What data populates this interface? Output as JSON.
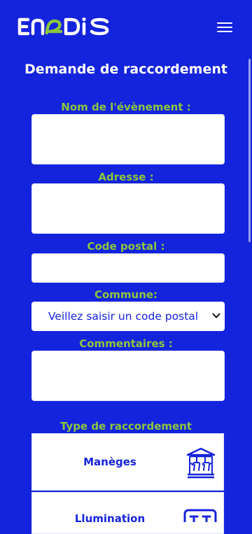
{
  "header": {
    "logo_text": "ENEDIS",
    "menu_icon": "hamburger-icon"
  },
  "form": {
    "title": "Demande de raccordement",
    "event_name_label": "Nom de l'évènement :",
    "event_name_value": "",
    "address_label": "Adresse :",
    "address_value": "",
    "postal_code_label": "Code postal :",
    "postal_code_value": "",
    "commune_label": "Commune:",
    "commune_selected": "Veillez saisir un code postal",
    "comments_label": "Commentaires :",
    "comments_value": "",
    "connection_type_label": "Type de raccordement",
    "connection_types": [
      {
        "label": "Manèges",
        "icon": "carousel-icon"
      },
      {
        "label": "Llumination",
        "icon": "display-icon"
      }
    ]
  },
  "colors": {
    "background": "#1423dc",
    "accent_green": "#8cc63f",
    "white": "#ffffff"
  }
}
